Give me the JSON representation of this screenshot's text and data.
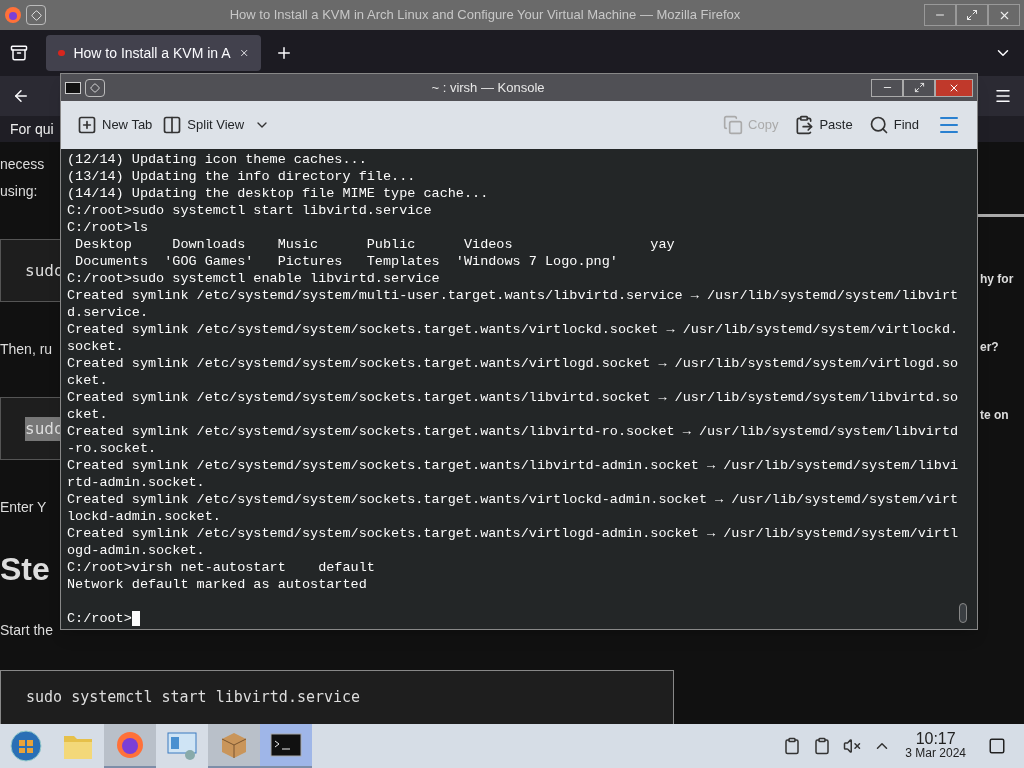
{
  "browser": {
    "title": "How to Install a KVM in Arch Linux and Configure Your Virtual Machine — Mozilla Firefox",
    "tab": {
      "title": "How to Install a KVM in A",
      "selected": true
    },
    "notice": "For qui",
    "article_left": [
      {
        "kind": "text",
        "lines": [
          "necess",
          "using:"
        ]
      },
      {
        "kind": "code",
        "text": "sudo",
        "selected": false
      },
      {
        "kind": "text",
        "lines": [
          "Then, ru"
        ]
      },
      {
        "kind": "code",
        "text": "sudo",
        "selected": true
      },
      {
        "kind": "text",
        "lines": [
          "Enter Y"
        ]
      },
      {
        "kind": "heading",
        "lines": [
          "Ste"
        ]
      },
      {
        "kind": "text",
        "lines": [
          "Start the"
        ]
      }
    ],
    "article_right": [
      "hy for",
      "er?",
      "te on"
    ],
    "code_block": "sudo systemctl start libvirtd.service"
  },
  "konsole": {
    "title": "~ : virsh — Konsole",
    "toolbar_left": [
      {
        "kind": "new-tab",
        "label": "New Tab",
        "disabled": false
      },
      {
        "kind": "split-view",
        "label": "Split View",
        "disabled": false
      }
    ],
    "toolbar_right": [
      {
        "kind": "copy",
        "label": "Copy",
        "disabled": true
      },
      {
        "kind": "paste",
        "label": "Paste",
        "disabled": false
      },
      {
        "kind": "find",
        "label": "Find",
        "disabled": false
      }
    ],
    "lines": [
      "(12/14) Updating icon theme caches...",
      "(13/14) Updating the info directory file...",
      "(14/14) Updating the desktop file MIME type cache...",
      "C:/root>sudo systemctl start libvirtd.service",
      "C:/root>ls",
      " Desktop     Downloads    Music      Public      Videos                 yay",
      " Documents  'GOG Games'   Pictures   Templates  'Windows 7 Logo.png'",
      "C:/root>sudo systemctl enable libvirtd.service",
      "Created symlink /etc/systemd/system/multi-user.target.wants/libvirtd.service → /usr/lib/systemd/system/libvirt",
      "d.service.",
      "Created symlink /etc/systemd/system/sockets.target.wants/virtlockd.socket → /usr/lib/systemd/system/virtlockd.",
      "socket.",
      "Created symlink /etc/systemd/system/sockets.target.wants/virtlogd.socket → /usr/lib/systemd/system/virtlogd.so",
      "cket.",
      "Created symlink /etc/systemd/system/sockets.target.wants/libvirtd.socket → /usr/lib/systemd/system/libvirtd.so",
      "cket.",
      "Created symlink /etc/systemd/system/sockets.target.wants/libvirtd-ro.socket → /usr/lib/systemd/system/libvirtd",
      "-ro.socket.",
      "Created symlink /etc/systemd/system/sockets.target.wants/libvirtd-admin.socket → /usr/lib/systemd/system/libvi",
      "rtd-admin.socket.",
      "Created symlink /etc/systemd/system/sockets.target.wants/virtlockd-admin.socket → /usr/lib/systemd/system/virt",
      "lockd-admin.socket.",
      "Created symlink /etc/systemd/system/sockets.target.wants/virtlogd-admin.socket → /usr/lib/systemd/system/virtl",
      "ogd-admin.socket.",
      "C:/root>virsh net-autostart    default",
      "Network default marked as autostarted"
    ],
    "prompt": "C:/root>"
  },
  "taskbar": {
    "items": [
      {
        "kind": "start",
        "open": false,
        "focused": false
      },
      {
        "kind": "folder",
        "open": false,
        "focused": false
      },
      {
        "kind": "firefox",
        "open": true,
        "focused": false
      },
      {
        "kind": "monitor",
        "open": false,
        "focused": false
      },
      {
        "kind": "package",
        "open": true,
        "focused": false
      },
      {
        "kind": "terminal",
        "open": true,
        "focused": true
      }
    ],
    "muted": true,
    "time": "10:17",
    "date": "3 Mar 2024"
  }
}
